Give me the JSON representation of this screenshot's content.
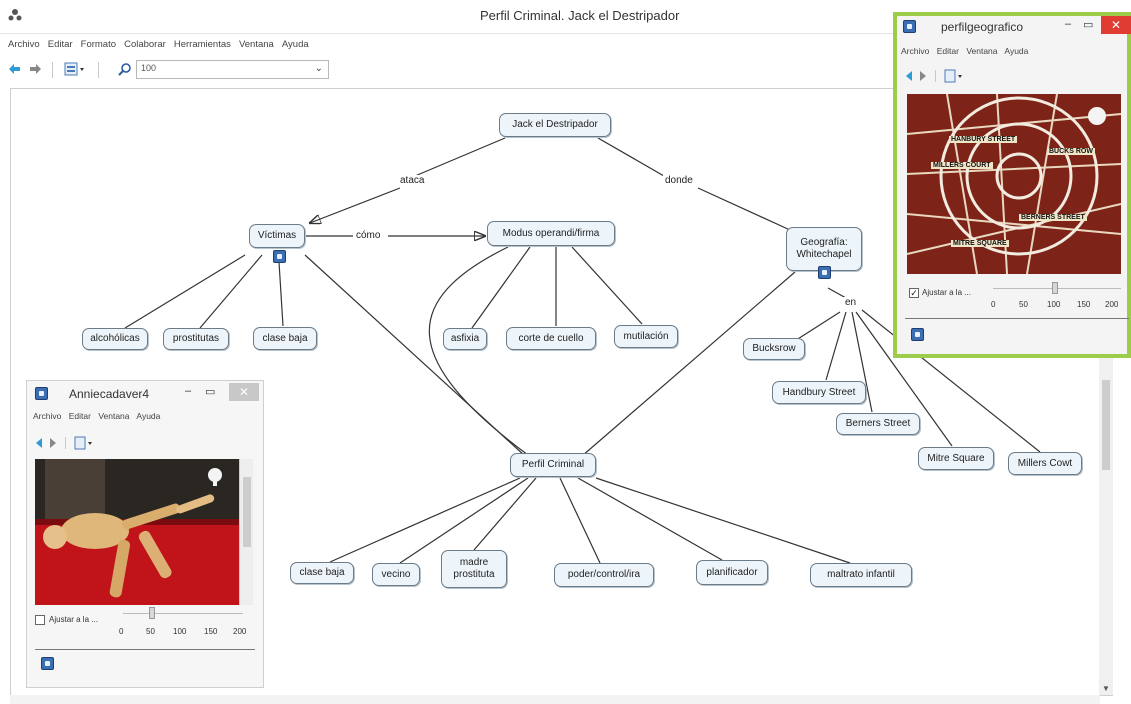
{
  "window": {
    "title": "Perfil Criminal. Jack el Destripador",
    "menu": [
      "Archivo",
      "Editar",
      "Formato",
      "Colaborar",
      "Herramientas",
      "Ventana",
      "Ayuda"
    ],
    "zoom_value": "100",
    "accent": "#3b6fb3"
  },
  "nodes": {
    "jack": "Jack el Destripador",
    "victimas": "Víctimas",
    "modus": "Modus operandi/firma",
    "geografia_1": "Geografía:",
    "geografia_2": "Whitechapel",
    "alcoholicas": "alcohólicas",
    "prostitutas": "prostitutas",
    "clase_baja_1": "clase baja",
    "asfixia": "asfixia",
    "corte": "corte de cuello",
    "mutilacion": "mutilación",
    "bucksrow": "Bucksrow",
    "handbury": "Handbury Street",
    "berners": "Berners Street",
    "mitre": "Mitre Square",
    "millers": "Millers Cowt",
    "perfil": "Perfil Criminal",
    "clase_baja_2": "clase baja",
    "vecino": "vecino",
    "madre_1": "madre",
    "madre_2": "prostituta",
    "poder": "poder/control/ira",
    "planificador": "planificador",
    "maltrato": "maltrato infantil"
  },
  "link_phrases": {
    "ataca": "ataca",
    "donde": "donde",
    "como": "cómo",
    "en": "en"
  },
  "annie_window": {
    "title": "Anniecadaver4",
    "menu": [
      "Archivo",
      "Editar",
      "Ventana",
      "Ayuda"
    ],
    "fit_label": "Ajustar a la ...",
    "fit_checked": false,
    "ticks": [
      "0",
      "50",
      "100",
      "150",
      "200"
    ],
    "slider_value": 50
  },
  "geo_window": {
    "title": "perfilgeografico",
    "menu": [
      "Archivo",
      "Editar",
      "Ventana",
      "Ayuda"
    ],
    "fit_label": "Ajustar a la ...",
    "fit_checked": true,
    "ticks": [
      "0",
      "50",
      "100",
      "150",
      "200"
    ],
    "slider_value": 100,
    "map_labels": [
      "HANBURY STREET",
      "MILLERS COURT",
      "BUCKS ROW",
      "BERNERS STREET",
      "MITRE SQUARE"
    ],
    "frame_color": "#9ccc4a"
  }
}
